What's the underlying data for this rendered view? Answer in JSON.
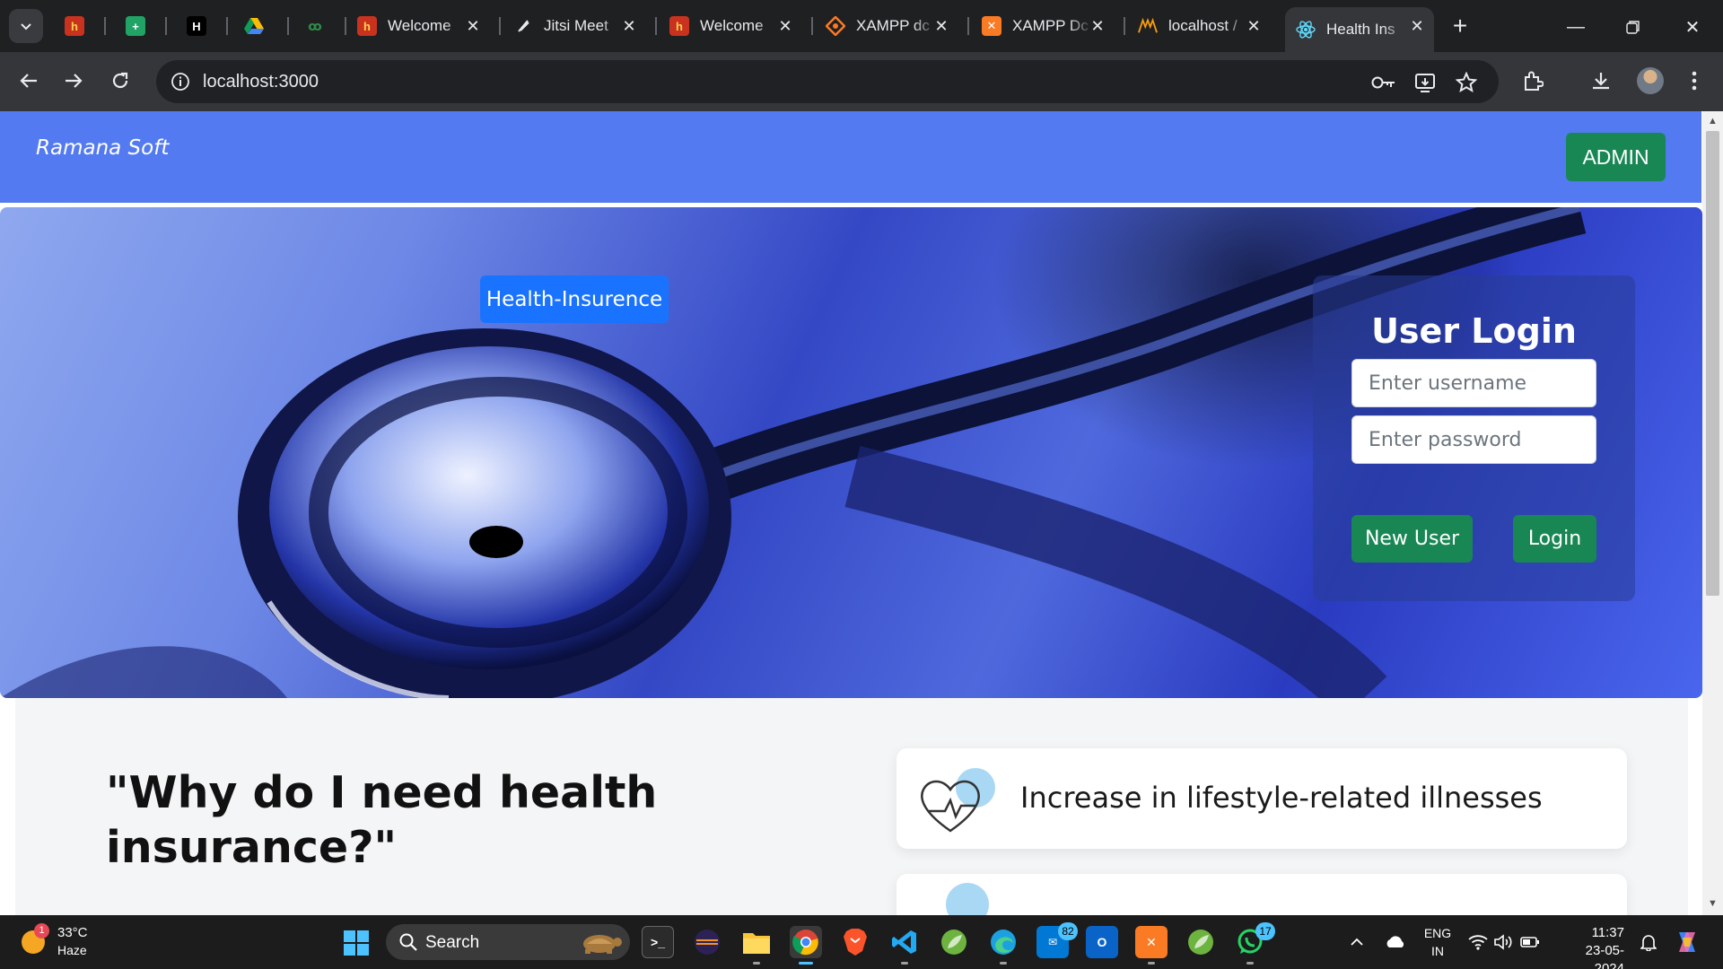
{
  "browser": {
    "tabs": [
      {
        "title": "",
        "favicon": "bookmark-red-icon",
        "color": "#e8543b"
      },
      {
        "title": "",
        "favicon": "google-sheets-icon",
        "color": "#21a366"
      },
      {
        "title": "",
        "favicon": "hackerrank-icon",
        "color": "#000000"
      },
      {
        "title": "",
        "favicon": "google-drive-icon",
        "color": "#fbbc04"
      },
      {
        "title": "",
        "favicon": "geeksforgeeks-icon",
        "color": "#2f8d46"
      },
      {
        "title": "Welcome",
        "favicon": "welcome-red-icon",
        "color": "#e8543b"
      },
      {
        "title": "Jitsi Meet",
        "favicon": "jitsi-icon",
        "color": "#e8eaed"
      },
      {
        "title": "Welcome",
        "favicon": "welcome-red-icon",
        "color": "#e8543b"
      },
      {
        "title": "XAMPP dc",
        "favicon": "xampp-diamond-icon",
        "color": "#fb7a24"
      },
      {
        "title": "XAMPP Dc",
        "favicon": "xampp-icon",
        "color": "#fb7a24"
      },
      {
        "title": "localhost /",
        "favicon": "phpmyadmin-icon",
        "color": "#f89c0e"
      },
      {
        "title": "Health Ins",
        "favicon": "react-icon",
        "color": "#61dafb"
      }
    ],
    "url": "localhost:3000"
  },
  "page": {
    "brand": "Ramana Soft",
    "admin_label": "ADMIN",
    "hero_badge": "Health-Insurence",
    "login": {
      "title": "User Login",
      "username_placeholder": "Enter username",
      "password_placeholder": "Enter password",
      "new_user_label": "New User",
      "login_label": "Login"
    },
    "why_title": "\"Why do I need health insurance?\"",
    "features": [
      {
        "text": "Increase in lifestyle-related illnesses",
        "icon": "heart-pulse-icon"
      }
    ]
  },
  "taskbar": {
    "weather": {
      "temp": "33°C",
      "condition": "Haze",
      "alert_count": "1"
    },
    "search_label": "Search",
    "badges": {
      "outlook": "82",
      "whatsapp": "17"
    },
    "lang_line1": "ENG",
    "lang_line2": "IN",
    "time": "11:37",
    "date": "23-05-2024"
  },
  "colors": {
    "navbar": "#537af0",
    "admin_button": "#198754",
    "hero_badge": "#1a73ff",
    "accent": "#4cc2ff"
  }
}
